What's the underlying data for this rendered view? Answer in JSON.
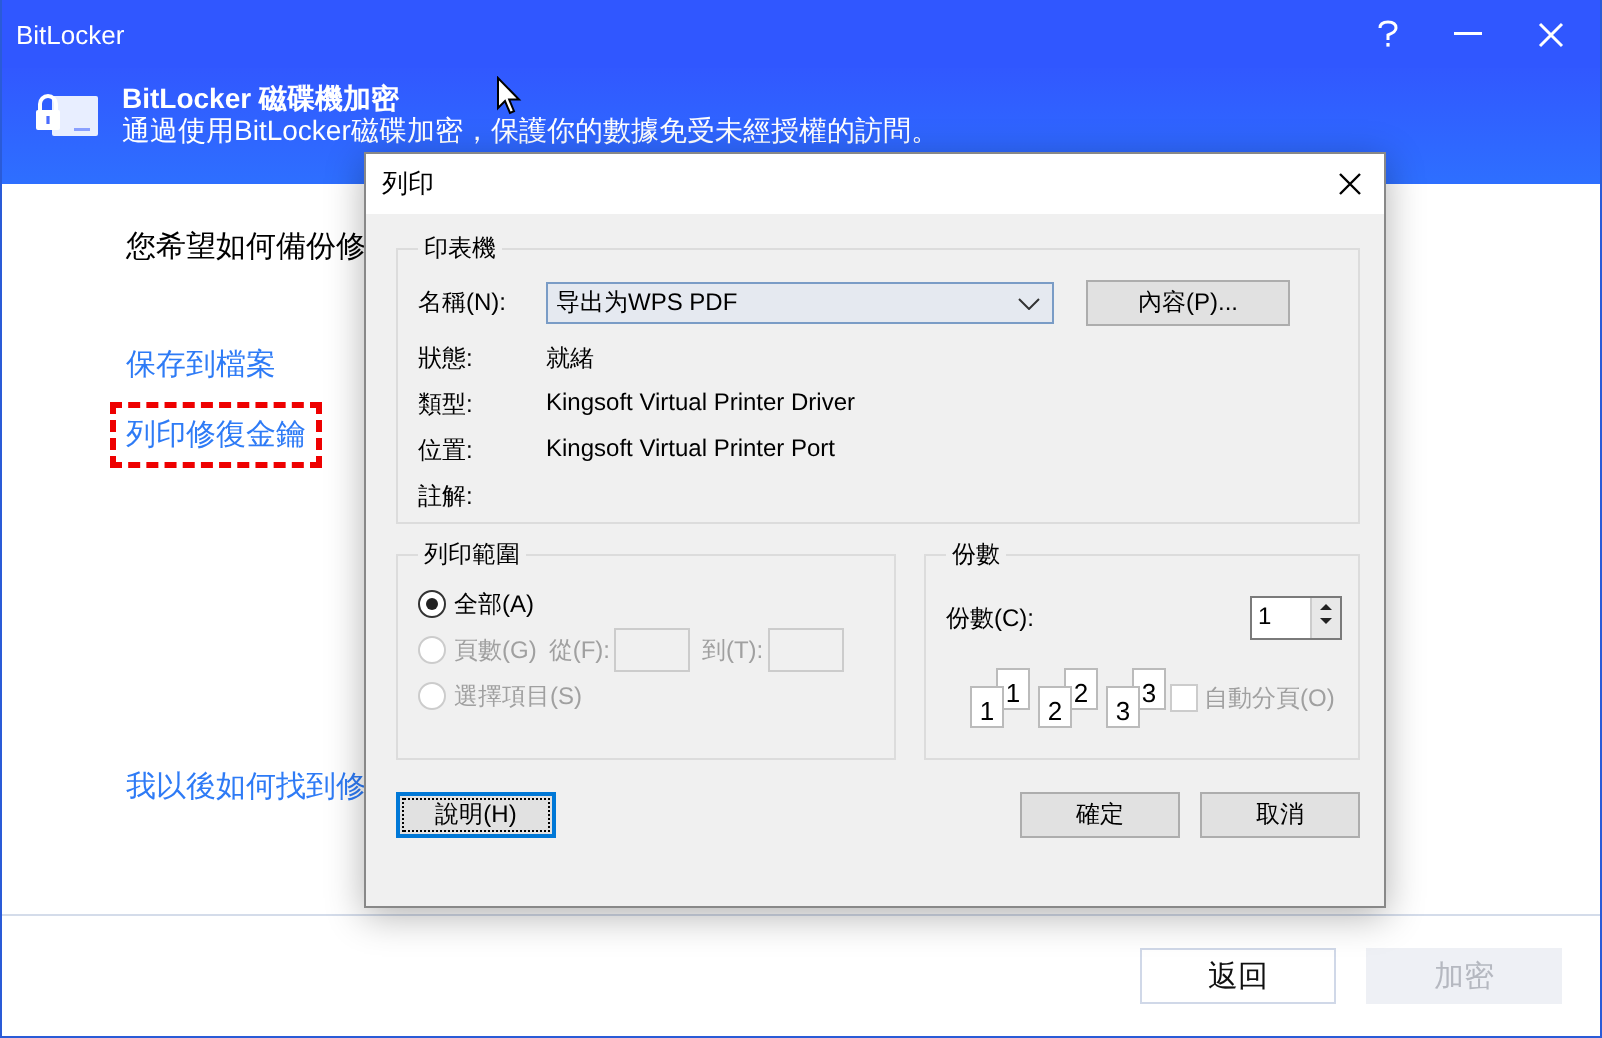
{
  "window": {
    "title": "BitLocker"
  },
  "header": {
    "title": "BitLocker 磁碟機加密",
    "subtitle": "通過使用BitLocker磁碟加密，保護你的數據免受未經授權的訪問。"
  },
  "body": {
    "question": "您希望如何備份修",
    "options": [
      {
        "label": "保存到檔案",
        "highlighted": false
      },
      {
        "label": "列印修復金鑰",
        "highlighted": true
      }
    ],
    "help_link": "我以後如何找到修"
  },
  "footer": {
    "buttons": [
      {
        "label": "返回",
        "disabled": false
      },
      {
        "label": "加密",
        "disabled": true
      }
    ]
  },
  "print_dialog": {
    "title": "列印",
    "printer": {
      "legend": "印表機",
      "name_label": "名稱(N):",
      "name_value": "导出为WPS PDF",
      "properties_button": "內容(P)...",
      "info": [
        {
          "label": "狀態:",
          "value": "就緒"
        },
        {
          "label": "類型:",
          "value": "Kingsoft Virtual Printer Driver"
        },
        {
          "label": "位置:",
          "value": "Kingsoft Virtual Printer Port"
        },
        {
          "label": "註解:"
        }
      ]
    },
    "range": {
      "legend": "列印範圍",
      "options": [
        {
          "label": "全部(A)",
          "selected": true,
          "disabled": false
        },
        {
          "label": "頁數(G)",
          "selected": false,
          "disabled": true
        },
        {
          "label": "選擇項目(S)",
          "selected": false,
          "disabled": true
        }
      ],
      "from_label": "從(F):",
      "to_label": "到(T):"
    },
    "copies": {
      "legend": "份數",
      "label": "份數(C):",
      "value": "1",
      "pages": [
        {
          "back": "1",
          "front": "1"
        },
        {
          "back": "2",
          "front": "2"
        },
        {
          "back": "3",
          "front": "3"
        }
      ],
      "collate": {
        "label": "自動分頁(O)",
        "checked": false,
        "disabled": true
      }
    },
    "buttons": [
      {
        "label": "說明(H)",
        "focused": true
      },
      {
        "label": "確定",
        "focused": false
      },
      {
        "label": "取消",
        "focused": false
      }
    ]
  }
}
